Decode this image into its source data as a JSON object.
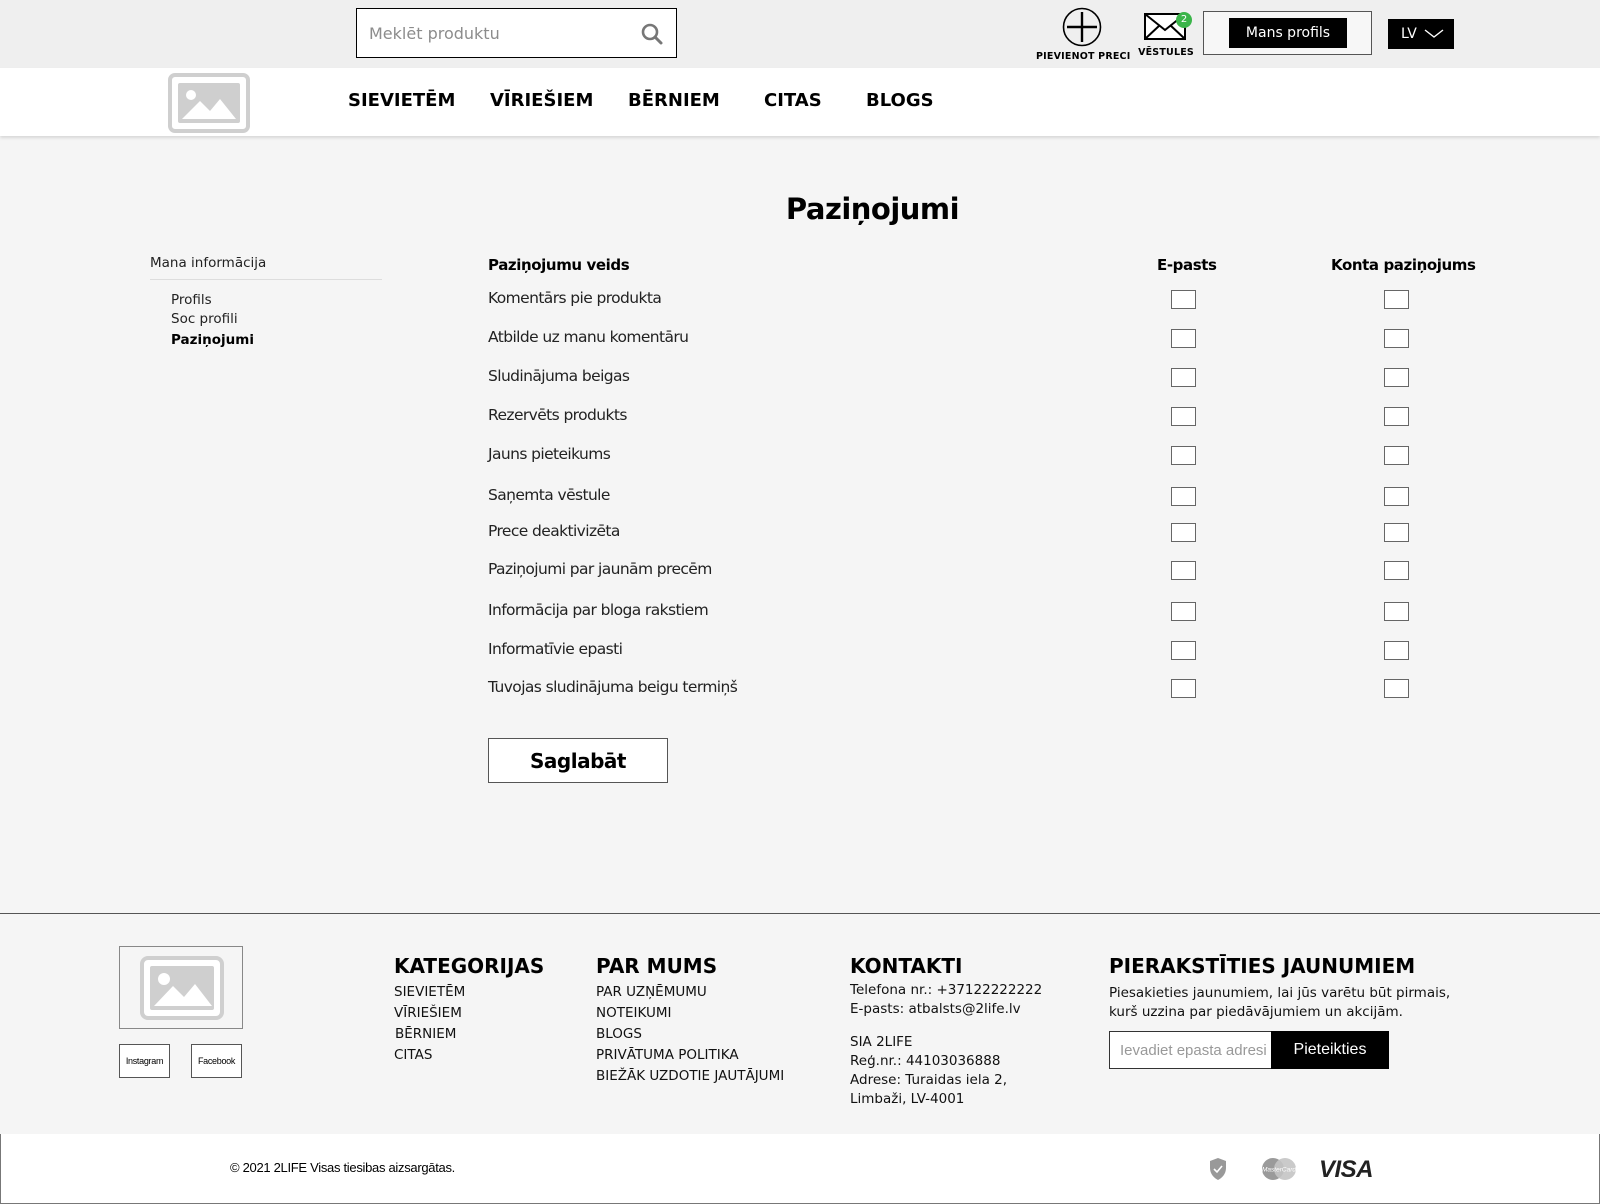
{
  "header": {
    "search_placeholder": "Meklēt produktu",
    "add_product_label": "PIEVIENOT PRECI",
    "messages_label": "VĒSTULES",
    "messages_count": "2",
    "profile_button": "Mans profils",
    "language": "LV"
  },
  "nav": {
    "items": [
      "SIEVIETĒM",
      "VĪRIEŠIEM",
      "BĒRNIEM",
      "CITAS",
      "BLOGS"
    ]
  },
  "page": {
    "title": "Paziņojumi"
  },
  "sidebar": {
    "heading": "Mana informācija",
    "links": [
      "Profils",
      "Soc profili",
      "Paziņojumi"
    ],
    "active_index": 2
  },
  "notifications": {
    "col_type": "Paziņojumu veids",
    "col_email": "E-pasts",
    "col_account": "Konta paziņojums",
    "rows": [
      {
        "label": "Komentārs pie produkta",
        "email": false,
        "account": false
      },
      {
        "label": "Atbilde uz manu komentāru",
        "email": false,
        "account": false
      },
      {
        "label": "Sludinājuma beigas",
        "email": false,
        "account": false
      },
      {
        "label": "Rezervēts produkts",
        "email": false,
        "account": false
      },
      {
        "label": "Jauns pieteikums",
        "email": false,
        "account": false
      },
      {
        "label": "Saņemta vēstule",
        "email": false,
        "account": false
      },
      {
        "label": "Prece deaktivizēta",
        "email": false,
        "account": false
      },
      {
        "label": "Paziņojumi par jaunām precēm",
        "email": false,
        "account": false
      },
      {
        "label": "Informācija par bloga rakstiem",
        "email": false,
        "account": false
      },
      {
        "label": "Informatīvie epasti",
        "email": false,
        "account": false
      },
      {
        "label": "Tuvojas sludinājuma beigu termiņš",
        "email": false,
        "account": false
      }
    ],
    "save_label": "Saglabāt"
  },
  "footer": {
    "social": [
      "Instagram",
      "Facebook"
    ],
    "categories": {
      "heading": "KATEGORIJAS",
      "links": [
        "SIEVIETĒM",
        "VĪRIEŠIEM",
        "BĒRNIEM",
        "CITAS"
      ]
    },
    "about": {
      "heading": "PAR MUMS",
      "links": [
        "PAR UZŅĒMUMU",
        "NOTEIKUMI",
        "BLOGS",
        "PRIVĀTUMA POLITIKA",
        "BIEŽĀK UZDOTIE JAUTĀJUMI"
      ]
    },
    "contacts": {
      "heading": "KONTAKTI",
      "phone": "Telefona nr.: +37122222222",
      "email": "E-pasts:  atbalsts@2life.lv",
      "company": "SIA 2LIFE",
      "reg": "Reģ.nr.: 44103036888",
      "address1": "Adrese: Turaidas iela 2,",
      "address2": "Limbaži, LV-4001"
    },
    "newsletter": {
      "heading": "PIERAKSTĪTIES JAUNUMIEM",
      "text1": "Piesakieties jaunumiem, lai jūs varētu būt pirmais,",
      "text2": "kurš uzzina par piedāvājumiem un akcijām.",
      "placeholder": "Ievadiet epasta adresi",
      "button": "Pieteikties"
    },
    "copyright": "© 2021 2LIFE Visas tiesibas aizsargātas.",
    "payments": {
      "mastercard_text": "MasterCard",
      "visa": "VISA"
    }
  },
  "colors": {
    "badge": "#3bb54a",
    "primary": "#000000",
    "background": "#f5f5f5"
  }
}
